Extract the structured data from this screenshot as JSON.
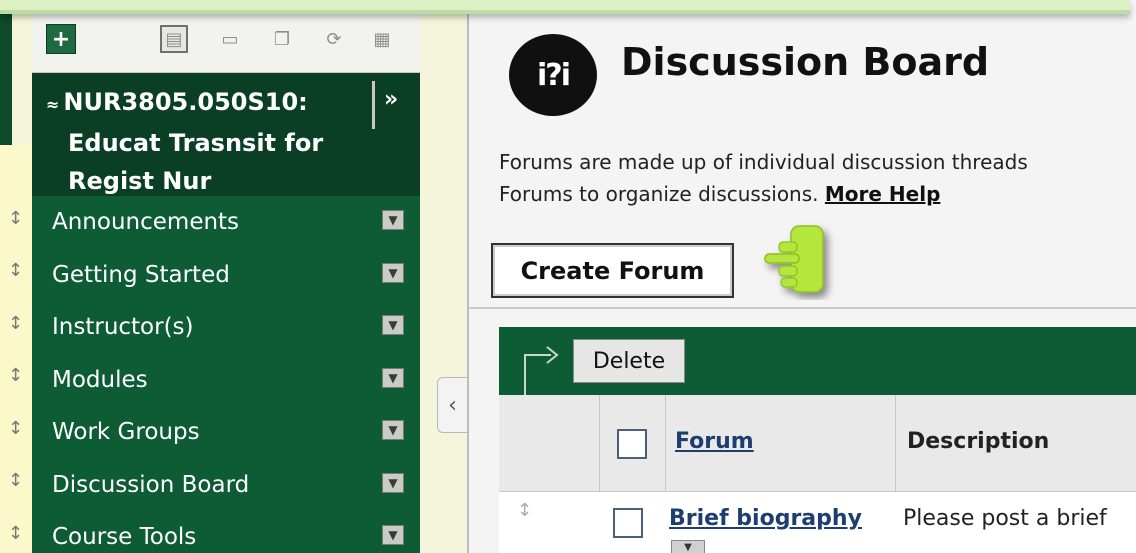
{
  "menu": {
    "toolbar": {
      "add_icon": "plus-icon",
      "view_icons": [
        "list-view-icon",
        "folder-view-icon",
        "window-view-icon",
        "refresh-icon",
        "grid-view-icon"
      ]
    },
    "course": {
      "line1": "NUR3805.050S10:",
      "line2": "Educat Trasnsit for",
      "line3": "Regist Nur",
      "expand_label": "»"
    },
    "items": [
      {
        "label": "Announcements"
      },
      {
        "label": "Getting Started"
      },
      {
        "label": "Instructor(s)"
      },
      {
        "label": "Modules"
      },
      {
        "label": "Work Groups"
      },
      {
        "label": "Discussion Board"
      },
      {
        "label": "Course Tools"
      }
    ]
  },
  "main": {
    "title": "Discussion Board",
    "icon_text": "i?i",
    "description_line1": "Forums are made up of individual discussion threads",
    "description_line2": "Forums to organize discussions.",
    "more_help": "More Help",
    "create_forum": "Create Forum",
    "table": {
      "delete_label": "Delete",
      "columns": {
        "forum": "Forum",
        "description": "Description"
      },
      "rows": [
        {
          "forum": "Brief biography",
          "description": "Please post a brief"
        }
      ]
    }
  },
  "colors": {
    "menu_green": "#0d5c36",
    "course_head": "#0b3f25",
    "banner": "#ddf0c3",
    "pointer_hand": "#b5e63c"
  }
}
